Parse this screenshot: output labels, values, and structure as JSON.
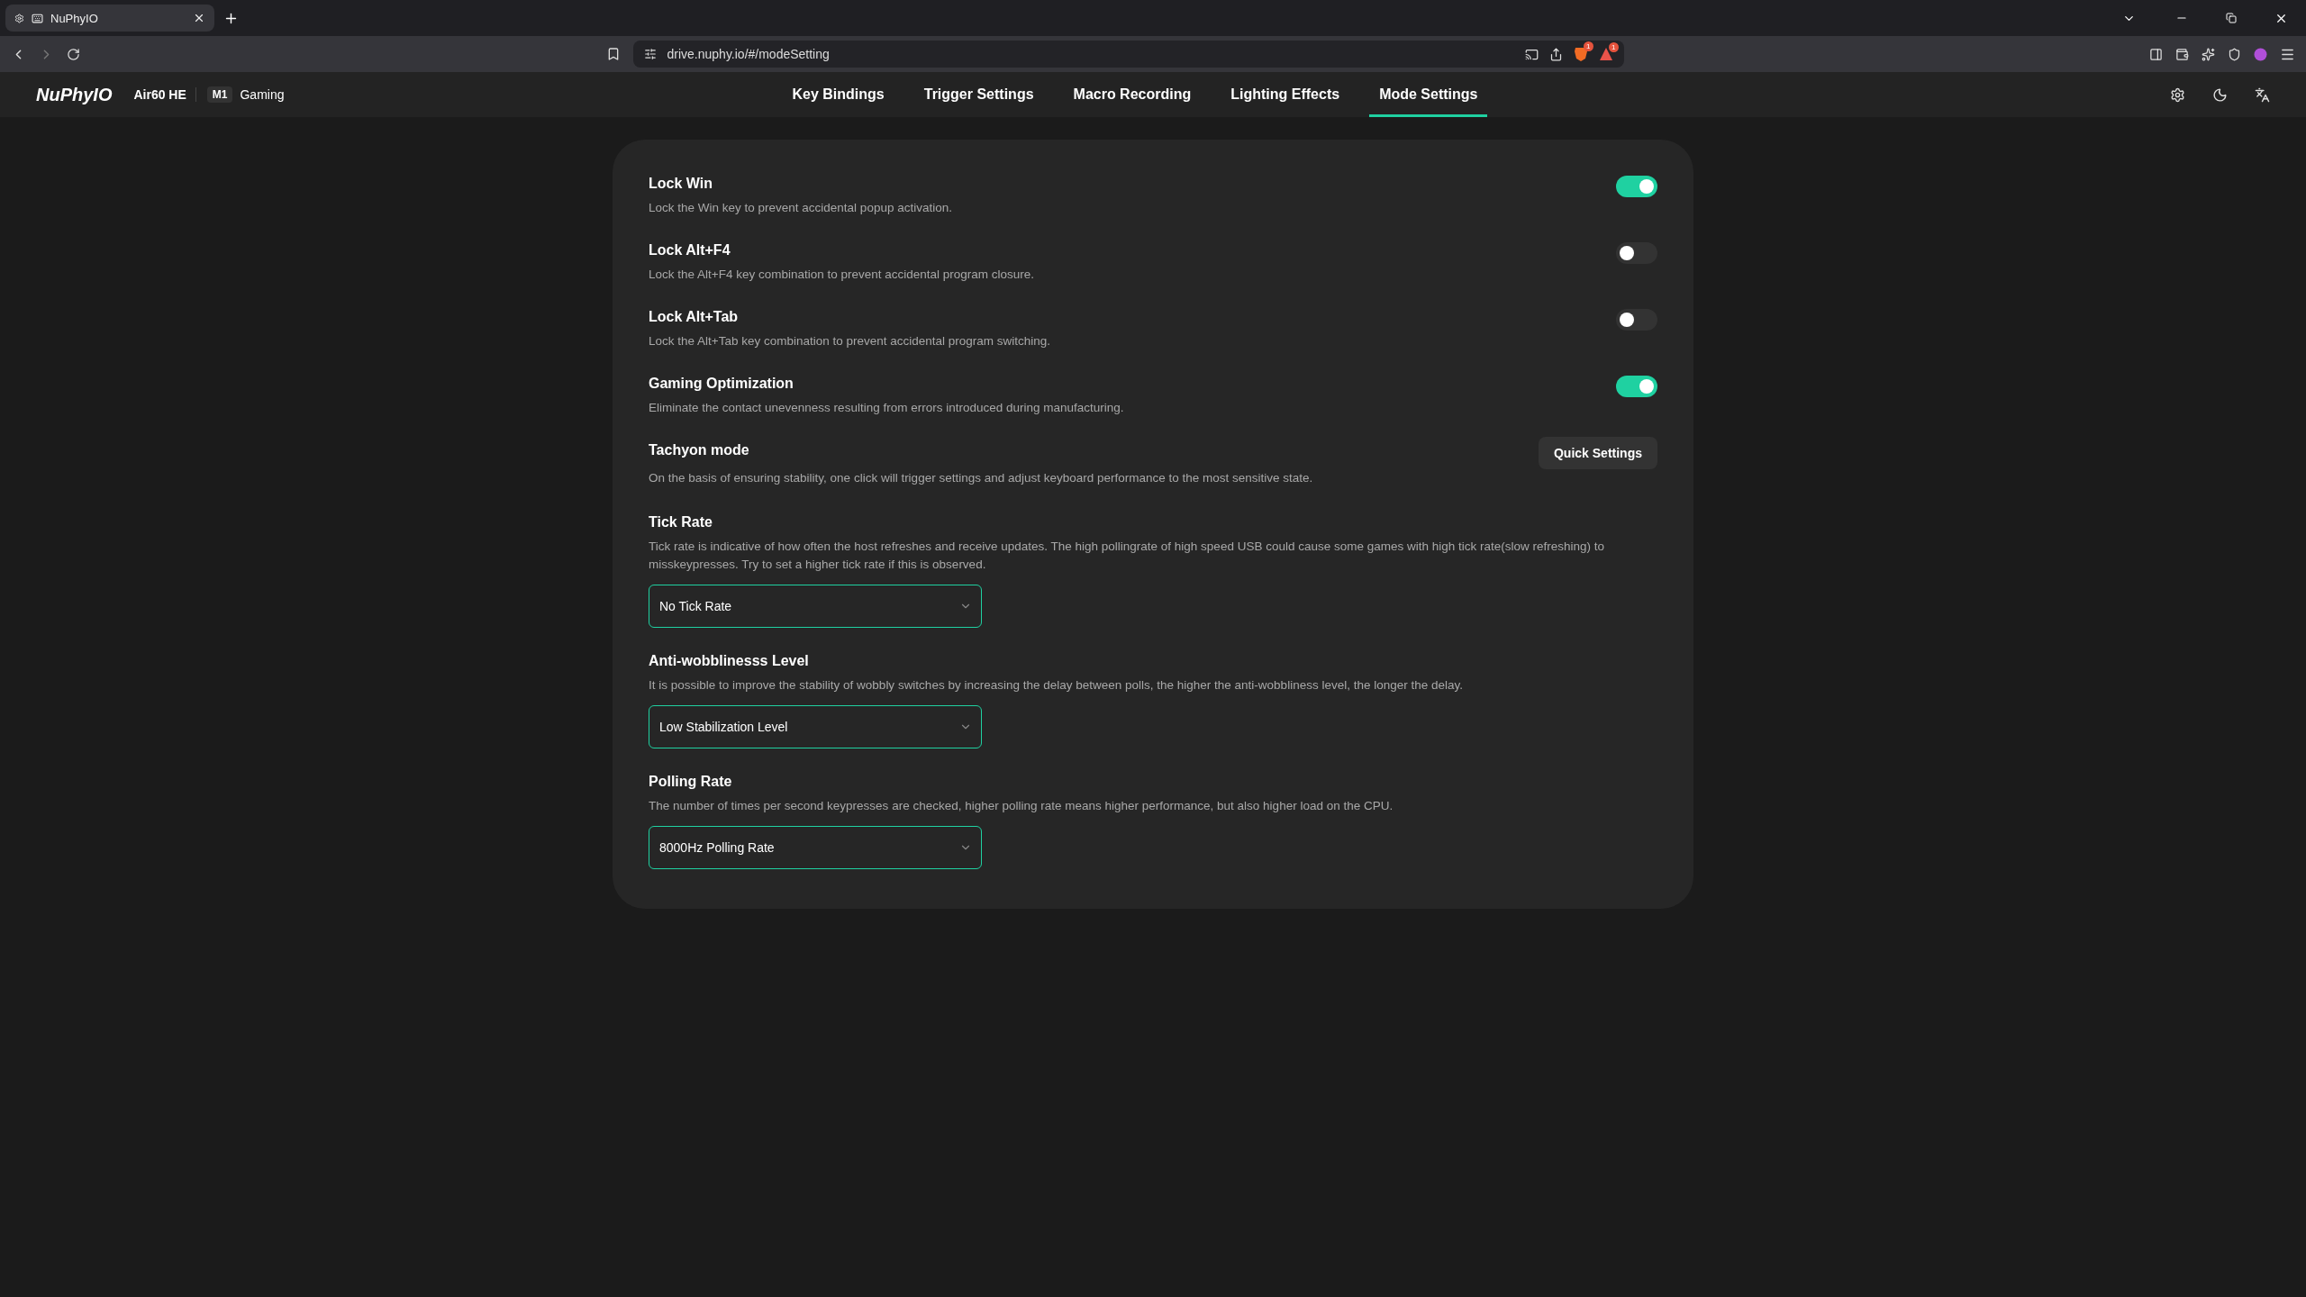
{
  "browser": {
    "tabs": [
      {
        "title": "NuPhyIO",
        "selected": true
      }
    ],
    "address": "drive.nuphy.io/#/modeSetting",
    "badges": [
      "1",
      "1"
    ]
  },
  "app": {
    "logo": "NuPhyIO",
    "device": "Air60 HE",
    "mode_badge": "M1",
    "mode": "Gaming",
    "nav": [
      {
        "label": "Key Bindings",
        "selected": false
      },
      {
        "label": "Trigger Settings",
        "selected": false
      },
      {
        "label": "Macro Recording",
        "selected": false
      },
      {
        "label": "Lighting Effects",
        "selected": false
      },
      {
        "label": "Mode Settings",
        "selected": true
      }
    ]
  },
  "settings": [
    {
      "kind": "toggle",
      "title": "Lock Win",
      "description": "Lock the Win key to prevent accidental popup activation.",
      "on": true
    },
    {
      "kind": "toggle",
      "title": "Lock Alt+F4",
      "description": "Lock the Alt+F4 key combination to prevent accidental program closure.",
      "on": false
    },
    {
      "kind": "toggle",
      "title": "Lock Alt+Tab",
      "description": "Lock the Alt+Tab key combination to prevent accidental program switching.",
      "on": false
    },
    {
      "kind": "toggle",
      "title": "Gaming Optimization",
      "description": "Eliminate the contact unevenness resulting from errors introduced during manufacturing.",
      "on": true
    },
    {
      "kind": "button",
      "title": "Tachyon mode",
      "description": "On the basis of ensuring stability, one click will trigger settings and adjust keyboard performance to the most sensitive state.",
      "button": "Quick Settings"
    },
    {
      "kind": "select",
      "title": "Tick Rate",
      "description": "Tick rate is indicative of how often the host refreshes and receive updates. The high pollingrate of high speed USB could cause some games with high tick rate(slow refreshing) to misskeypresses. Try to set a higher tick rate if this is observed.",
      "value": "No Tick Rate"
    },
    {
      "kind": "select",
      "title": "Anti-wobblinesss Level",
      "description": "It is possible to improve the stability of wobbly switches by increasing the delay between polls, the higher the anti-wobbliness level, the longer the delay.",
      "value": "Low Stabilization Level"
    },
    {
      "kind": "select",
      "title": "Polling Rate",
      "description": "The number of times per second keypresses are checked, higher polling rate means higher performance, but also higher load on the CPU.",
      "value": "8000Hz Polling Rate"
    }
  ]
}
